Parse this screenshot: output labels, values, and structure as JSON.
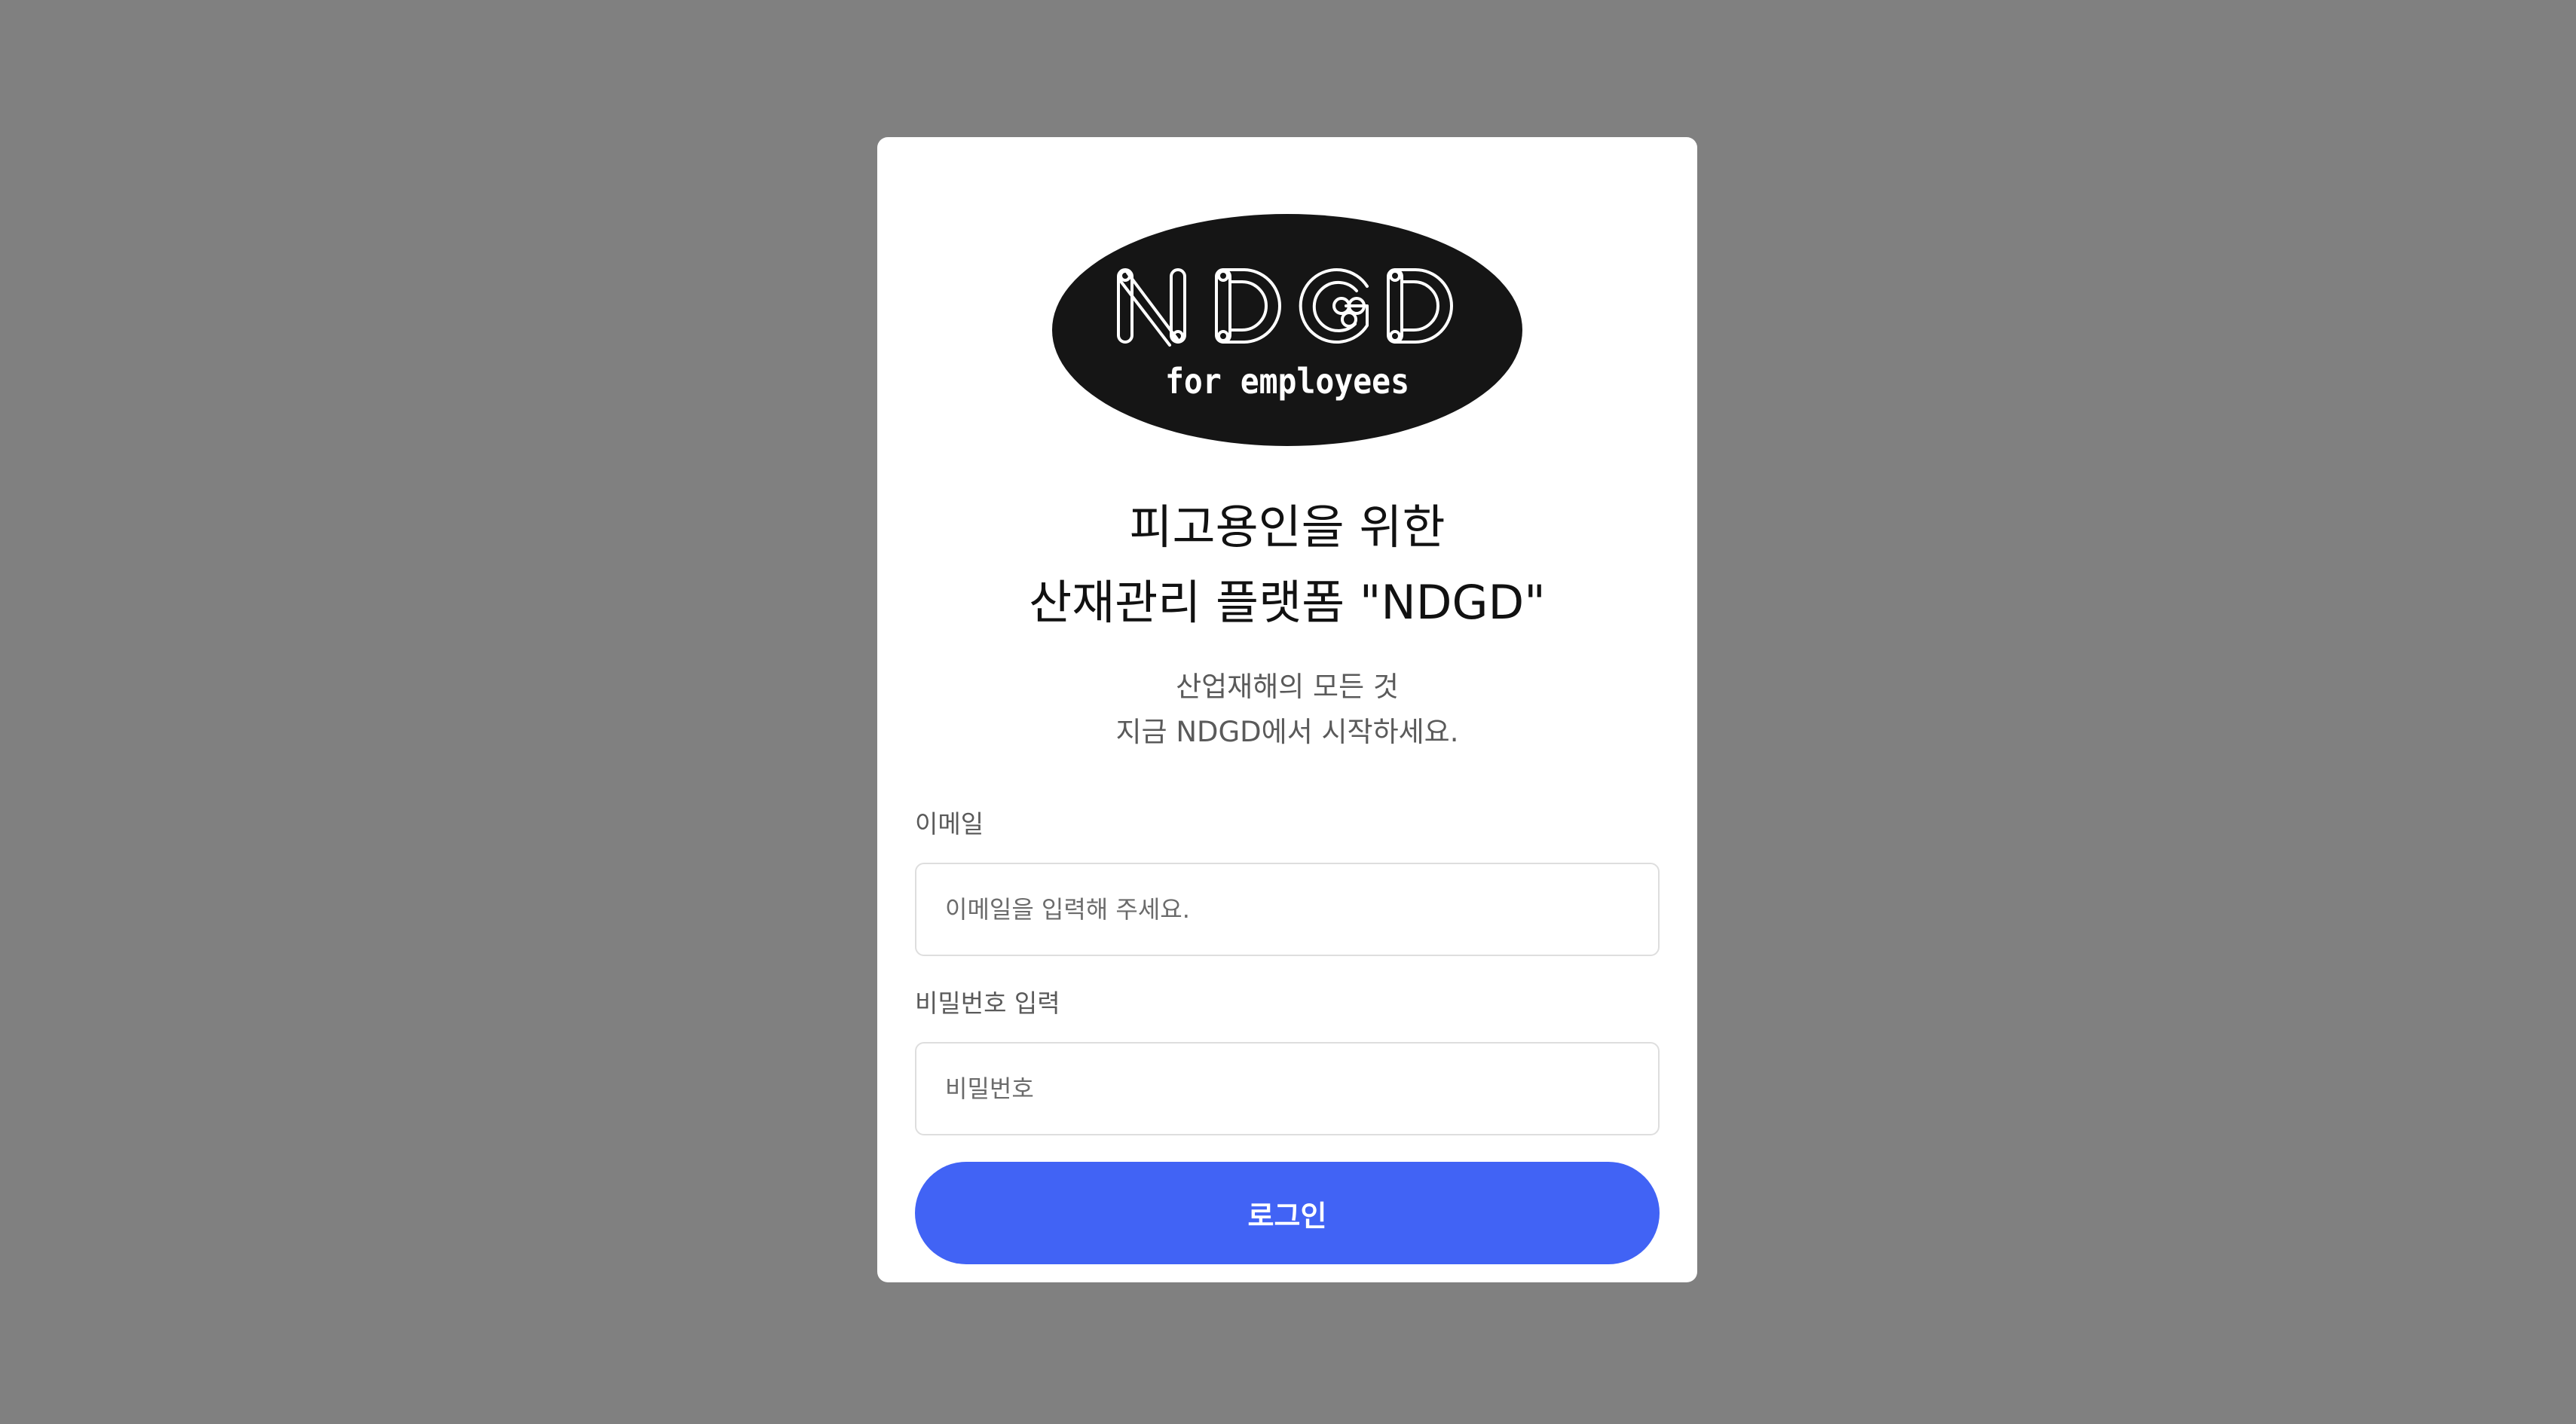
{
  "logo": {
    "wordmark": "NDGD",
    "tagline": "for employees"
  },
  "heading": {
    "line1": "피고용인을 위한",
    "line2": "산재관리 플랫폼 \"NDGD\""
  },
  "intro": {
    "line1": "산업재해의 모든 것",
    "line2": "지금 NDGD에서 시작하세요."
  },
  "form": {
    "email_label": "이메일",
    "email_placeholder": "이메일을 입력해 주세요.",
    "email_value": "",
    "password_label": "비밀번호 입력",
    "password_placeholder": "비밀번호",
    "password_value": "",
    "login_label": "로그인"
  },
  "colors": {
    "background": "#808080",
    "card": "#ffffff",
    "accent": "#4163f5",
    "logo_fill": "#151515"
  }
}
